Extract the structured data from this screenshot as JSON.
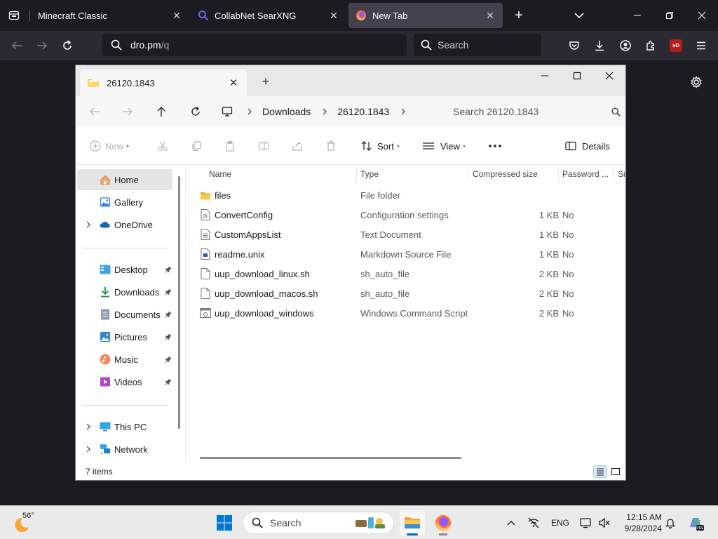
{
  "browser": {
    "tabs": [
      {
        "title": "Minecraft Classic",
        "active": false
      },
      {
        "title": "CollabNet SearXNG",
        "active": false
      },
      {
        "title": "New Tab",
        "active": true
      }
    ],
    "url": {
      "host": "dro.pm",
      "path": "/q"
    },
    "search_placeholder": "Search"
  },
  "explorer": {
    "tab_title": "26120.1843",
    "breadcrumb": [
      "Downloads",
      "26120.1843"
    ],
    "search_placeholder": "Search 26120.1843",
    "commands": {
      "new": "New",
      "sort": "Sort",
      "view": "View",
      "details": "Details"
    },
    "sidebar": {
      "home": "Home",
      "gallery": "Gallery",
      "onedrive": "OneDrive",
      "desktop": "Desktop",
      "downloads": "Downloads",
      "documents": "Documents",
      "pictures": "Pictures",
      "music": "Music",
      "videos": "Videos",
      "thispc": "This PC",
      "network": "Network"
    },
    "columns": {
      "name": "Name",
      "type": "Type",
      "compressed_size": "Compressed size",
      "password": "Password ...",
      "extra": "Si"
    },
    "files": [
      {
        "name": "files",
        "type": "File folder",
        "size": "",
        "password": "",
        "icon": "folder-icon"
      },
      {
        "name": "ConvertConfig",
        "type": "Configuration settings",
        "size": "1 KB",
        "password": "No",
        "icon": "config-file-icon"
      },
      {
        "name": "CustomAppsList",
        "type": "Text Document",
        "size": "1 KB",
        "password": "No",
        "icon": "text-file-icon"
      },
      {
        "name": "readme.unix",
        "type": "Markdown Source File",
        "size": "1 KB",
        "password": "No",
        "icon": "markdown-file-icon"
      },
      {
        "name": "uup_download_linux.sh",
        "type": "sh_auto_file",
        "size": "2 KB",
        "password": "No",
        "icon": "blank-file-icon"
      },
      {
        "name": "uup_download_macos.sh",
        "type": "sh_auto_file",
        "size": "2 KB",
        "password": "No",
        "icon": "blank-file-icon"
      },
      {
        "name": "uup_download_windows",
        "type": "Windows Command Script",
        "size": "2 KB",
        "password": "No",
        "icon": "cmd-script-icon"
      }
    ],
    "status": "7 items"
  },
  "taskbar": {
    "weather_temp": "56°",
    "search_placeholder": "Search",
    "language": "ENG",
    "time": "12:15 AM",
    "date": "9/28/2024"
  },
  "colors": {
    "accent": "#0067c0",
    "folder": "#f4c04e",
    "firefox_dark": "#1c1b22"
  }
}
